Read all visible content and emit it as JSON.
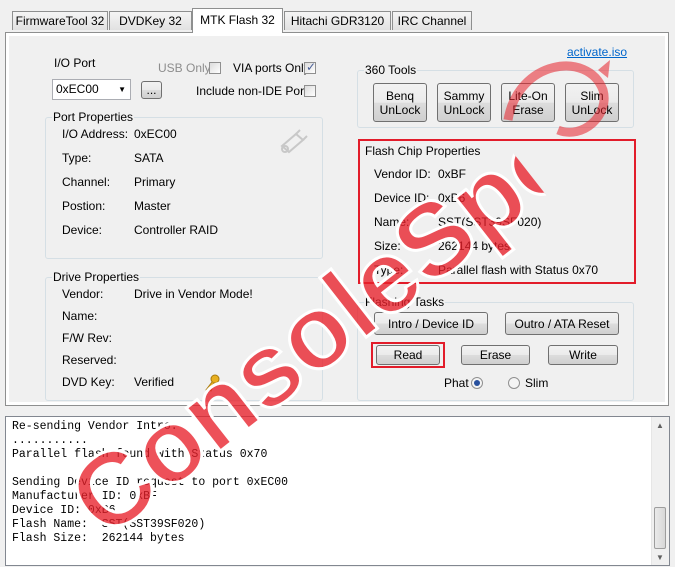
{
  "tabs": [
    {
      "label": "FirmwareTool 32"
    },
    {
      "label": "DVDKey 32"
    },
    {
      "label": "MTK Flash 32"
    },
    {
      "label": "Hitachi GDR3120"
    },
    {
      "label": "IRC Channel"
    }
  ],
  "active_tab": "MTK Flash 32",
  "io_port": {
    "label": "I/O Port",
    "selected": "0xEC00",
    "browse_label": "...",
    "usb_only_label": "USB Only",
    "usb_only_checked": false,
    "via_only_label": "VIA ports Only",
    "via_only_checked": true,
    "include_non_ide_label": "Include non-IDE Ports",
    "include_non_ide_checked": false
  },
  "port_properties": {
    "title": "Port Properties",
    "rows": [
      {
        "key": "I/O Address:",
        "value": "0xEC00"
      },
      {
        "key": "Type:",
        "value": "SATA"
      },
      {
        "key": "Channel:",
        "value": "Primary"
      },
      {
        "key": "Postion:",
        "value": "Master"
      },
      {
        "key": "Device:",
        "value": "Controller RAID"
      }
    ]
  },
  "drive_properties": {
    "title": "Drive Properties",
    "rows": [
      {
        "key": "Vendor:",
        "value": "Drive in Vendor Mode!"
      },
      {
        "key": "Name:",
        "value": ""
      },
      {
        "key": "F/W Rev:",
        "value": ""
      },
      {
        "key": "Reserved:",
        "value": ""
      },
      {
        "key": "DVD Key:",
        "value": "Verified"
      }
    ]
  },
  "activate_link": "activate.iso",
  "tools_360": {
    "title": "360 Tools",
    "buttons": [
      "Benq\nUnLock",
      "Sammy\nUnLock",
      "Lite-On\nErase",
      "Slim\nUnLock"
    ]
  },
  "flash_chip": {
    "title": "Flash Chip Properties",
    "rows": [
      {
        "key": "Vendor ID:",
        "value": "0xBF"
      },
      {
        "key": "Device ID:",
        "value": "0xB6"
      },
      {
        "key": "Name:",
        "value": "SST(SST39SF020)"
      },
      {
        "key": "Size:",
        "value": "262144 bytes"
      },
      {
        "key": "Type:",
        "value": "Parallel flash with Status 0x70"
      }
    ]
  },
  "flashing_tasks": {
    "title": "Flashing Tasks",
    "intro_label": "Intro / Device ID",
    "outro_label": "Outro / ATA Reset",
    "read_label": "Read",
    "erase_label": "Erase",
    "write_label": "Write",
    "phat_label": "Phat",
    "phat_selected": true,
    "slim_label": "Slim",
    "slim_selected": false
  },
  "console_log": "Re-sending Vendor Intro:\n...........\nParallel flash found with Status 0x70\n\nSending Device ID request to port 0xEC00\nManufacturer ID: 0xBF\nDevice ID: 0xB6\nFlash Name:  SST(SST39SF020)\nFlash Size:  262144 bytes",
  "watermark_text": "ConsoleSpot",
  "colors": {
    "highlight_box": "#e21c2a",
    "watermark": "#e8202a",
    "link": "#0066cc"
  }
}
